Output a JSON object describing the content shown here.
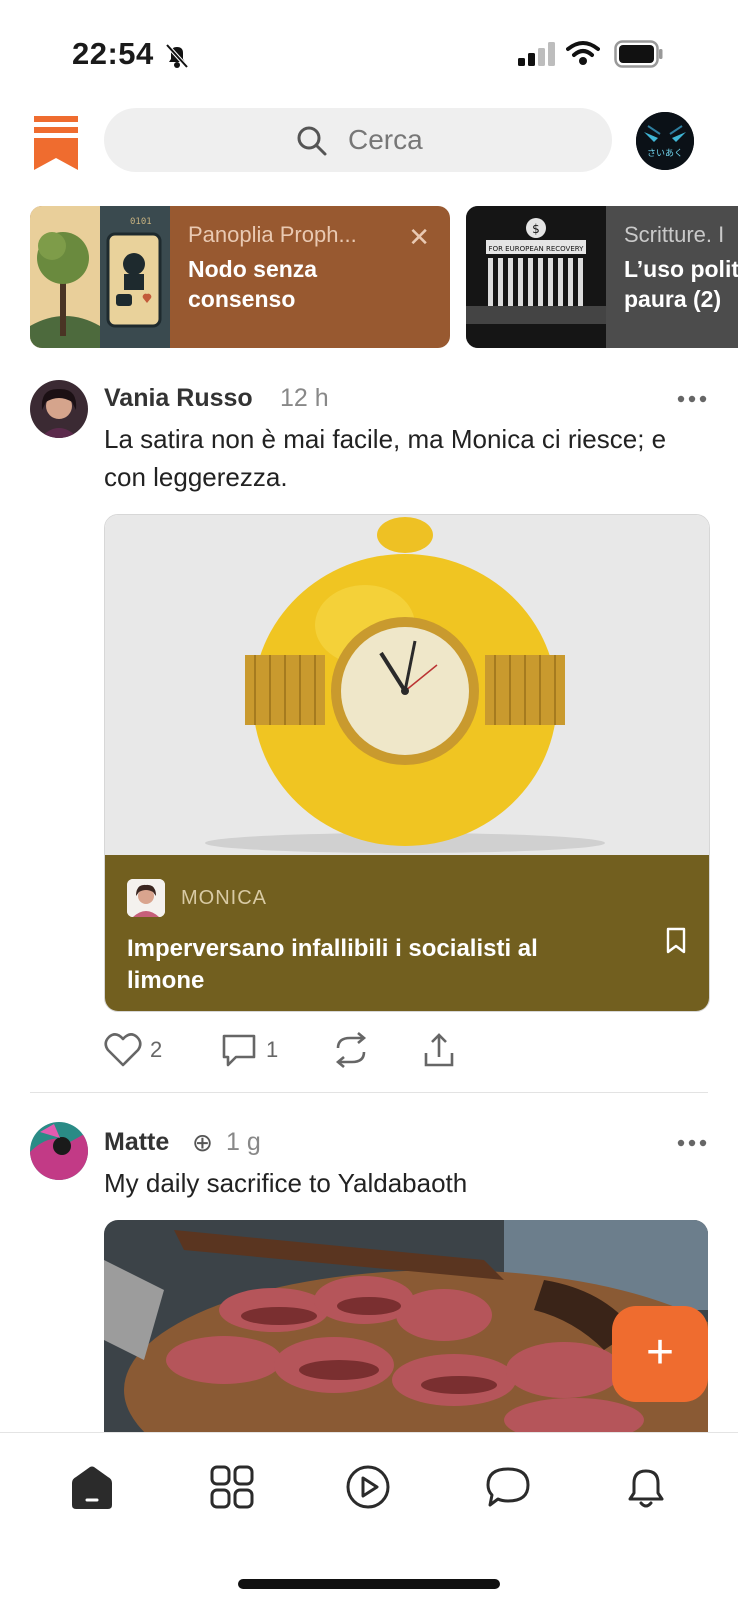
{
  "status_bar": {
    "time": "22:54",
    "icons": [
      "bell-slash-icon",
      "signal-icon",
      "wifi-icon",
      "battery-icon"
    ]
  },
  "header": {
    "logo": "bookmark-logo",
    "search_placeholder": "Cerca",
    "profile": "profile-avatar"
  },
  "stories": [
    {
      "subtitle": "Panoplia Proph...",
      "title": "Nodo senza consenso",
      "close": "✕"
    },
    {
      "subtitle": "Scritture. I",
      "title": "L’uso polit paura (2)",
      "thumb_text": "FOR EUROPEAN RECOVERY"
    }
  ],
  "posts": [
    {
      "author": "Vania Russo",
      "time": "12 h",
      "text": "La satira non è mai facile, ma Monica ci riesce; e con leggerezza.",
      "embed": {
        "publication": "MONICA",
        "title": "Imperversano infallibili i socialisti al limone"
      },
      "likes": "2",
      "comments": "1"
    },
    {
      "author": "Matte",
      "badge": "⊕",
      "time": "1 g",
      "text": "My daily sacrifice to Yaldabaoth"
    }
  ],
  "fab": "+",
  "nav": [
    "home-icon",
    "grid-icon",
    "play-icon",
    "chat-icon",
    "bell-icon"
  ],
  "colors": {
    "accent": "#ef6c2f",
    "card1": "#985930",
    "embed_footer": "#725f1f"
  }
}
